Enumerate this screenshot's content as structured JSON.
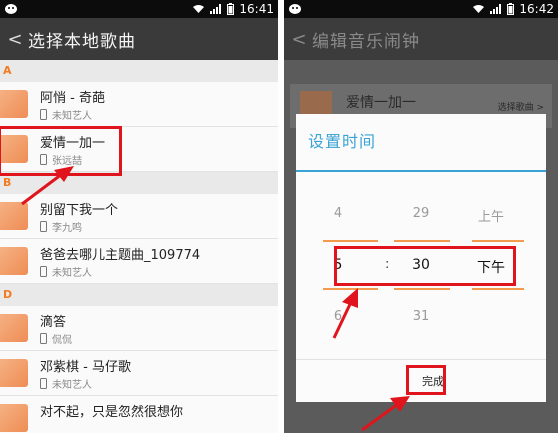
{
  "left": {
    "status": {
      "time": "16:41"
    },
    "title": "选择本地歌曲",
    "back_glyph": "<",
    "sections": [
      {
        "letter": "A",
        "items": [
          {
            "name": "阿悄 - 奇葩",
            "artist": "未知艺人"
          },
          {
            "name": "爱情一加一",
            "artist": "张远喆"
          }
        ]
      },
      {
        "letter": "B",
        "items": [
          {
            "name": "别留下我一个",
            "artist": "李九鸣"
          },
          {
            "name": "爸爸去哪儿主题曲_109774",
            "artist": "未知艺人"
          }
        ]
      },
      {
        "letter": "D",
        "items": [
          {
            "name": "滴答",
            "artist": "侃侃"
          },
          {
            "name": "邓紫棋 - 马仔歌",
            "artist": "未知艺人"
          },
          {
            "name": "对不起，只是忽然很想你",
            "artist": ""
          }
        ]
      }
    ]
  },
  "right": {
    "status": {
      "time": "16:42"
    },
    "title": "编辑音乐闹钟",
    "back_glyph": "<",
    "bg_song": "爱情一加一",
    "bg_choose": "选择歌曲 >",
    "dialog": {
      "title": "设置时间",
      "hour": {
        "prev": "4",
        "current": "5",
        "next": "6"
      },
      "separator": ":",
      "minute": {
        "prev": "29",
        "current": "30",
        "next": "31"
      },
      "ampm": {
        "prev": "上午",
        "current": "下午"
      },
      "done": "完成"
    }
  },
  "colors": {
    "accent_blue": "#3aa3d6",
    "accent_orange": "#f37b21",
    "highlight_red": "#e0141c"
  }
}
